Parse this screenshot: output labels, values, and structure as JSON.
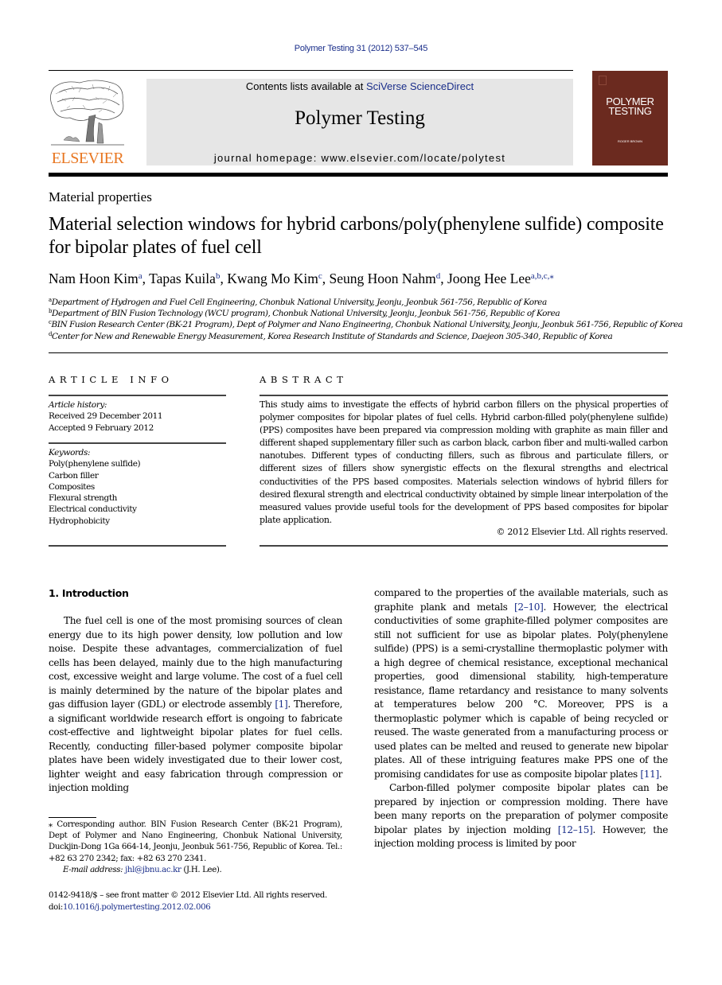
{
  "header": {
    "citation": "Polymer Testing 31 (2012) 537–545",
    "contents_prefix": "Contents lists available at ",
    "contents_link": "SciVerse ScienceDirect",
    "journal_title": "Polymer Testing",
    "homepage_prefix": "journal homepage: ",
    "homepage_url": "www.elsevier.com/locate/polytest",
    "publisher_logo_text": "ELSEVIER",
    "cover_title_line1": "POLYMER",
    "cover_title_line2": "TESTING",
    "cover_editor": "ROGER BROWN",
    "brand_color": "#e87722",
    "cover_color": "#6b2a1f",
    "link_color": "#1a2e8a"
  },
  "article": {
    "section": "Material properties",
    "title": "Material selection windows for hybrid carbons/poly(phenylene sulfide) composite for bipolar plates of fuel cell",
    "authors": [
      {
        "name": "Nam Hoon Kim",
        "sup": "a",
        "sep": ", "
      },
      {
        "name": "Tapas Kuila",
        "sup": "b",
        "sep": ", "
      },
      {
        "name": "Kwang Mo Kim",
        "sup": "c",
        "sep": ", "
      },
      {
        "name": "Seung Hoon Nahm",
        "sup": "d",
        "sep": ", "
      },
      {
        "name": "Joong Hee Lee",
        "sup": "a,b,c,⁎",
        "sep": ""
      }
    ],
    "affiliations": [
      {
        "key": "a",
        "text": "Department of Hydrogen and Fuel Cell Engineering, Chonbuk National University, Jeonju, Jeonbuk 561-756, Republic of Korea"
      },
      {
        "key": "b",
        "text": "Department of BIN Fusion Technology (WCU program), Chonbuk National University, Jeonju, Jeonbuk 561-756, Republic of Korea"
      },
      {
        "key": "c",
        "text": "BIN Fusion Research Center (BK-21 Program), Dept of Polymer and Nano Engineering, Chonbuk National University, Jeonju, Jeonbuk 561-756, Republic of Korea"
      },
      {
        "key": "d",
        "text": "Center for New and Renewable Energy Measurement, Korea Research Institute of Standards and Science, Daejeon 305-340, Republic of Korea"
      }
    ]
  },
  "article_info": {
    "heading": "ARTICLE INFO",
    "history_label": "Article history:",
    "received": "Received 29 December 2011",
    "accepted": "Accepted 9 February 2012",
    "keywords_label": "Keywords:",
    "keywords": [
      "Poly(phenylene sulfide)",
      "Carbon filler",
      "Composites",
      "Flexural strength",
      "Electrical conductivity",
      "Hydrophobicity"
    ]
  },
  "abstract": {
    "heading": "ABSTRACT",
    "text": "This study aims to investigate the effects of hybrid carbon fillers on the physical properties of polymer composites for bipolar plates of fuel cells. Hybrid carbon-filled poly(phenylene sulfide) (PPS) composites have been prepared via compression molding with graphite as main filler and different shaped supplementary filler such as carbon black, carbon fiber and multi-walled carbon nanotubes. Different types of conducting fillers, such as fibrous and particulate fillers, or different sizes of fillers show synergistic effects on the flexural strengths and electrical conductivities of the PPS based composites. Materials selection windows of hybrid fillers for desired flexural strength and electrical conductivity obtained by simple linear interpolation of the measured values provide useful tools for the devel­opment of PPS based composites for bipolar plate application.",
    "copyright": "© 2012 Elsevier Ltd. All rights reserved."
  },
  "body": {
    "intro_heading": "1.  Introduction",
    "p1_a": "The fuel cell is one of the most promising sources of clean energy due to its high power density, low pollution and low noise. Despite these advantages, commercializa­tion of fuel cells has been delayed, mainly due to the high manufacturing cost, excessive weight and large volume. The cost of a fuel cell is mainly determined by the nature of the bipolar plates and gas diffusion layer (GDL) or electrode assembly ",
    "ref1": "[1]",
    "p1_b": ". Therefore, a significant worldwide research effort is ongoing to fabricate cost-effective and lightweight bipolar plates for fuel cells. Recently, conducting filler-based polymer composite bipolar plates have been widely investigated due to their lower cost, lighter weight and easy fabrication through compression or injection molding compared to the properties of the available materials, such as graphite plank and metals ",
    "ref2": "[2–10]",
    "p1_c": ". However, the elec­trical conductivities of some graphite-filled polymer composites are still not sufficient for use as bipolar plates. Poly(phenylene sulfide) (PPS) is a semi-crystalline ther­moplastic polymer with a high degree of chemical resis­tance, exceptional mechanical properties, good dimensional stability, high-temperature resistance, flame retardancy and resistance to many solvents at tempera­tures below 200 °C. Moreover, PPS is a thermoplastic polymer which is capable of being recycled or reused. The waste generated from a manufacturing process or used plates can be melted and reused to generate new bipolar plates. All of these intriguing features make PPS one of the promising candidates for use as composite bipolar plates ",
    "ref3": "[11]",
    "p1_d": ".",
    "p2_a": "Carbon-filled polymer composite bipolar plates can be prepared by injection or compression molding. There have been many reports on the preparation of polymer composite bipolar plates by injection molding ",
    "ref4": "[12–15]",
    "p2_b": ". However, the injection molding process is limited by poor"
  },
  "footnote": {
    "corresponding": "⁎ Corresponding author. BIN Fusion Research Center (BK-21 Program), Dept of Polymer and Nano Engineering, Chonbuk National University, Duckjin-Dong 1Ga 664-14, Jeonju, Jeonbuk 561-756, Republic of Korea. Tel.: +82 63 270 2342; fax: +82 63 270 2341.",
    "email_label": "E-mail address:",
    "email": "jhl@jbnu.ac.kr",
    "email_suffix": " (J.H. Lee).",
    "front_matter": "0142-9418/$ – see front matter © 2012 Elsevier Ltd. All rights reserved.",
    "doi_prefix": "doi:",
    "doi": "10.1016/j.polymertesting.2012.02.006"
  }
}
